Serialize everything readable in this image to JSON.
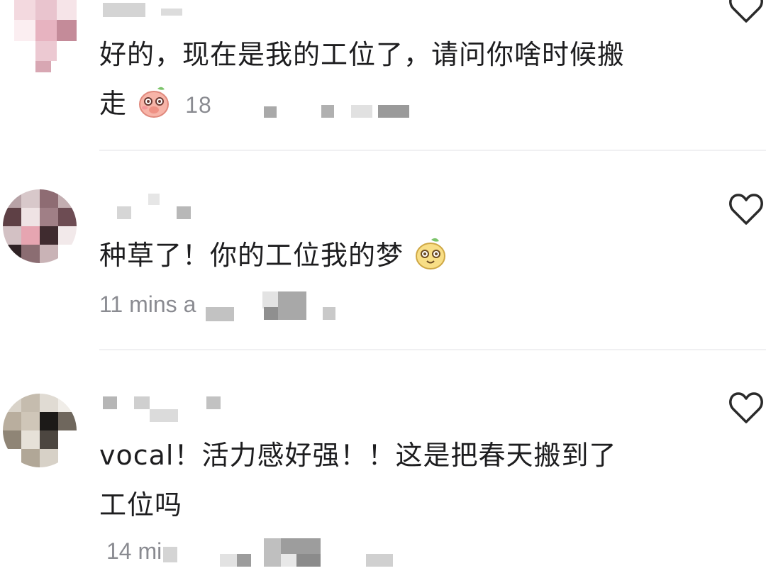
{
  "comments": [
    {
      "text_line1": "好的，现在是我的工位了，请问你啥时候搬",
      "text_line2": "走",
      "emoji": "blushing-peach-emoji",
      "likes": "18"
    },
    {
      "text_line1": "种草了！你的工位我的梦",
      "emoji": "smiling-pear-emoji",
      "time": "11 mins a"
    },
    {
      "text_line1": "vocal！活力感好强！！这是把春天搬到了",
      "text_line2": "工位吗",
      "time": "14 mi"
    }
  ],
  "icons": {
    "like": "heart-outline-icon"
  },
  "colors": {
    "text": "#1d1d1f",
    "meta": "#8a8b91",
    "divider": "#f0f0f2"
  }
}
